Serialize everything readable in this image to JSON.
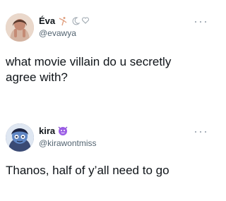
{
  "tweets": [
    {
      "display_name": "Éva",
      "handle": "@evawya",
      "text": "what movie villain do u secretly agree with?",
      "name_icons": [
        "dancer-icon",
        "crescent-moon-icon",
        "heart-icon"
      ]
    },
    {
      "display_name": "kira",
      "handle": "@kirawontmiss",
      "text": "Thanos, half of y’all need to go",
      "name_icons": [
        "purple-emoji-icon"
      ]
    }
  ],
  "colors": {
    "text": "#0f1419",
    "secondary": "#536471",
    "icon_purple": "#9b5de5"
  }
}
